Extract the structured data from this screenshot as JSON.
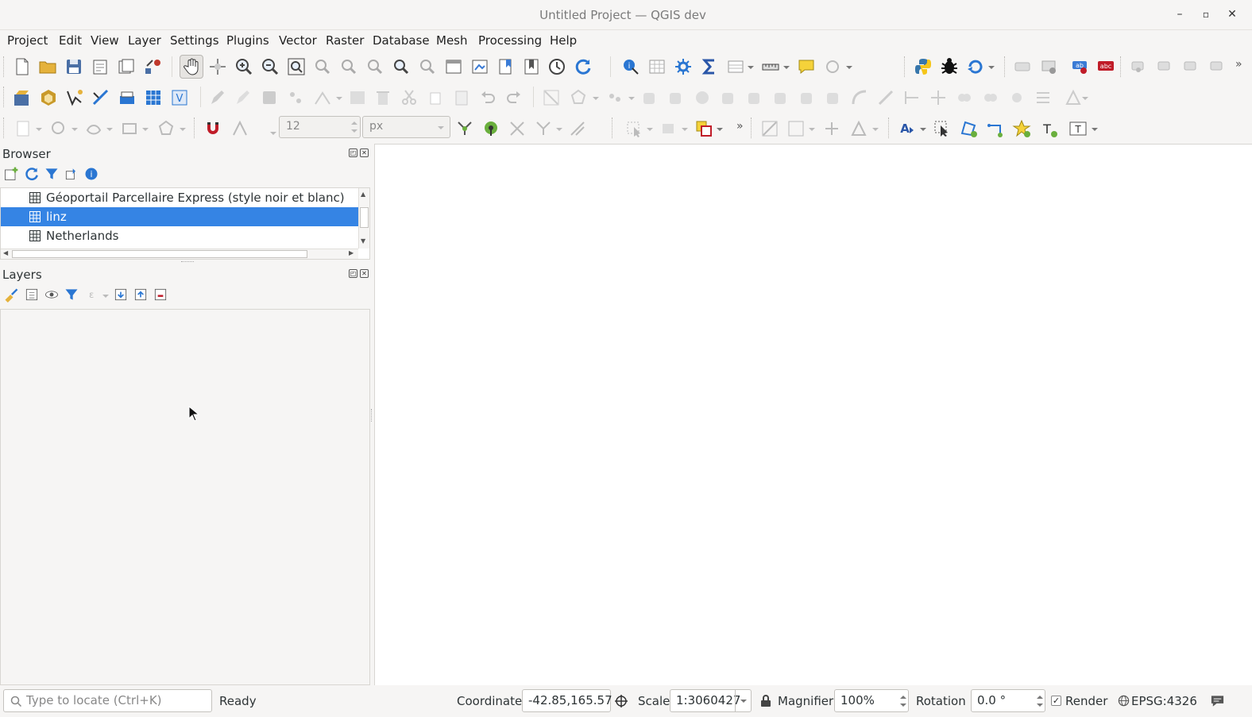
{
  "window": {
    "title": "Untitled Project — QGIS dev"
  },
  "menus": [
    "Project",
    "Edit",
    "View",
    "Layer",
    "Settings",
    "Plugins",
    "Vector",
    "Raster",
    "Database",
    "Mesh",
    "Processing",
    "Help"
  ],
  "toolbar": {
    "snapping_tolerance": "12",
    "snapping_units": "px",
    "overflow": "»"
  },
  "browser": {
    "title": "Browser",
    "items": [
      {
        "label": "Géoportail Parcellaire Express (style noir et blanc)",
        "selected": false
      },
      {
        "label": "linz",
        "selected": true
      },
      {
        "label": "Netherlands",
        "selected": false
      }
    ]
  },
  "layers": {
    "title": "Layers"
  },
  "statusbar": {
    "locator_placeholder": "Type to locate (Ctrl+K)",
    "status": "Ready",
    "coordinate_label": "Coordinate",
    "coordinate_value": "-42.85,165.57",
    "scale_label": "Scale",
    "scale_value": "1:3060427",
    "magnifier_label": "Magnifier",
    "magnifier_value": "100%",
    "rotation_label": "Rotation",
    "rotation_value": "0.0 °",
    "render_label": "Render",
    "render_checked": true,
    "crs": "EPSG:4326"
  },
  "colors": {
    "selection": "#3584e4",
    "accent": "#c01c28"
  }
}
